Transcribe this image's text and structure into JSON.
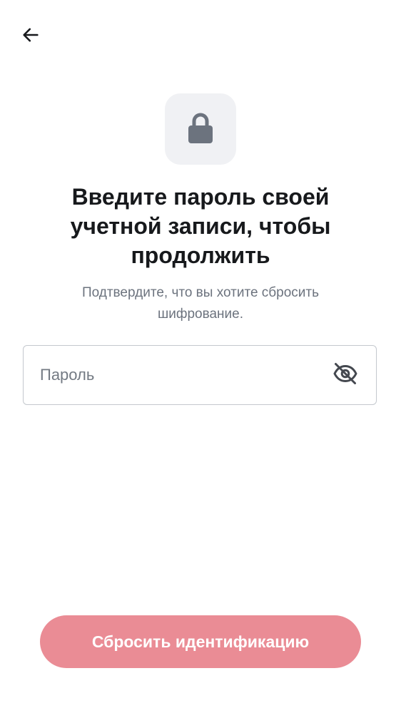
{
  "header": {
    "back_icon": "arrow-left-icon"
  },
  "hero": {
    "icon": "lock-icon",
    "tile_color": "#f0f1f4",
    "icon_color": "#6c737e"
  },
  "title": "Введите пароль своей учетной записи, чтобы продолжить",
  "subtitle": "Подтвердите, что вы хотите сбросить шифрование.",
  "password_field": {
    "placeholder": "Пароль",
    "value": "",
    "visibility_icon": "eye-off-icon"
  },
  "reset_button": {
    "label": "Сбросить идентификацию",
    "color": "#ea8c95"
  }
}
